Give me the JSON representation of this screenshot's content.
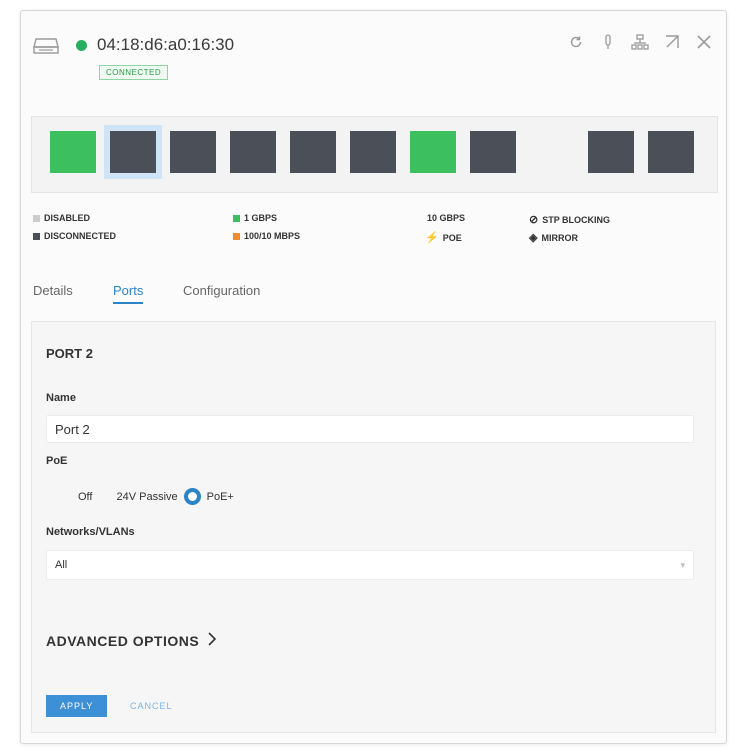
{
  "header": {
    "device_mac": "04:18:d6:a0:16:30",
    "status": "CONNECTED",
    "status_color": "#27ae60",
    "actions": [
      "refresh-icon",
      "locate-icon",
      "topology-icon",
      "popout-icon",
      "close-icon"
    ]
  },
  "ports": [
    {
      "state": "1gbps",
      "color": "#3cbf5f"
    },
    {
      "state": "disconnected",
      "color": "#4b4f57",
      "selected": true
    },
    {
      "state": "disconnected",
      "color": "#4b4f57"
    },
    {
      "state": "disconnected",
      "color": "#4b4f57"
    },
    {
      "state": "disconnected",
      "color": "#4b4f57"
    },
    {
      "state": "disconnected",
      "color": "#4b4f57"
    },
    {
      "state": "1gbps",
      "color": "#3cbf5f"
    },
    {
      "state": "disconnected",
      "color": "#4b4f57"
    },
    {
      "state": "disconnected",
      "color": "#4b4f57"
    },
    {
      "state": "disconnected",
      "color": "#4b4f57"
    }
  ],
  "legend": {
    "disabled": "DISABLED",
    "disconnected": "DISCONNECTED",
    "gbps1": "1 GBPS",
    "mbps": "100/10 MBPS",
    "gbps10": "10 GBPS",
    "poe": "POE",
    "stp": "STP BLOCKING",
    "mirror": "MIRROR",
    "colors": {
      "disabled": "#cccccc",
      "disconnected": "#4b4f57",
      "gbps1": "#3cbf5f",
      "mbps": "#f08c2d"
    }
  },
  "tabs": {
    "details": "Details",
    "ports": "Ports",
    "configuration": "Configuration",
    "active": "Ports"
  },
  "form": {
    "section_title": "PORT 2",
    "name_label": "Name",
    "name_value": "Port 2",
    "poe_label": "PoE",
    "poe_options": [
      "Off",
      "24V Passive",
      "PoE+"
    ],
    "poe_selected": "PoE+",
    "networks_label": "Networks/VLANs",
    "networks_value": "All",
    "advanced_label": "ADVANCED OPTIONS",
    "apply_label": "APPLY",
    "cancel_label": "CANCEL"
  }
}
